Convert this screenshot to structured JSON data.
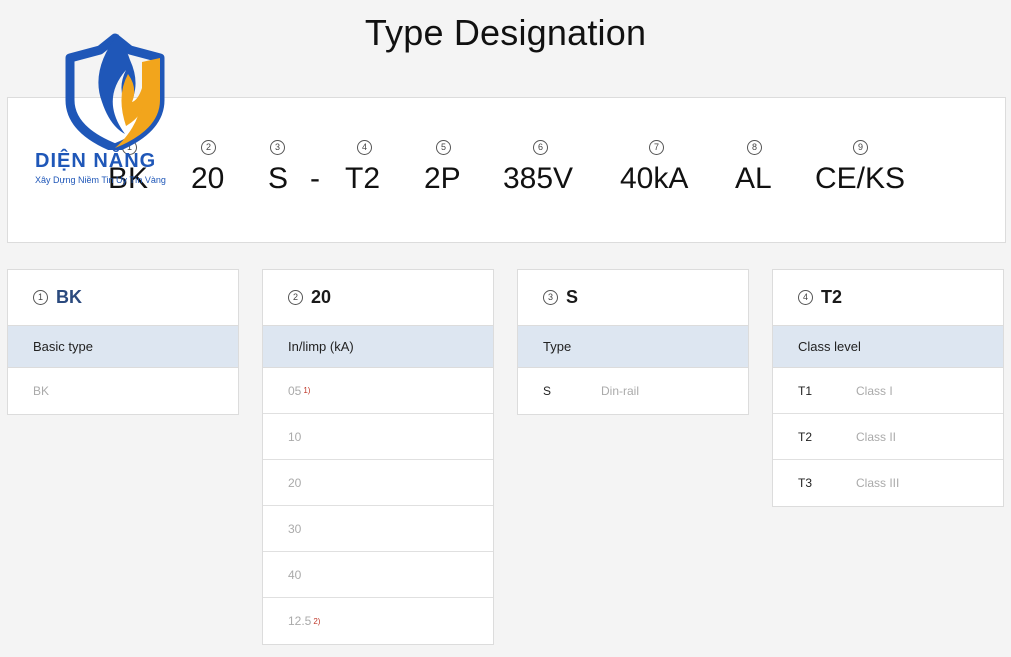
{
  "title": "Type Designation",
  "logo": {
    "name": "DIỆN NĂNG",
    "tagline": "Xây Dựng Niềm Tin Uy Tín Vàng"
  },
  "segments": [
    {
      "num": "1",
      "code": "BK"
    },
    {
      "num": "2",
      "code": "20"
    },
    {
      "num": "3",
      "code": "S"
    },
    {
      "sep": "-"
    },
    {
      "num": "4",
      "code": "T2"
    },
    {
      "num": "5",
      "code": "2P"
    },
    {
      "num": "6",
      "code": "385V"
    },
    {
      "num": "7",
      "code": "40kA"
    },
    {
      "num": "8",
      "code": "AL"
    },
    {
      "num": "9",
      "code": "CE/KS"
    }
  ],
  "cards": [
    {
      "num": "1",
      "title": "BK",
      "subtitle": "Basic type",
      "rows": [
        {
          "value": "BK"
        }
      ]
    },
    {
      "num": "2",
      "title": "20",
      "subtitle": "In/limp (kA)",
      "rows": [
        {
          "value": "05",
          "note": "1)"
        },
        {
          "value": "10"
        },
        {
          "value": "20"
        },
        {
          "value": "30"
        },
        {
          "value": "40"
        },
        {
          "value": "12.5",
          "note": "2)"
        }
      ]
    },
    {
      "num": "3",
      "title": "S",
      "subtitle": "Type",
      "rows": [
        {
          "key": "S",
          "value": "Din-rail"
        }
      ]
    },
    {
      "num": "4",
      "title": "T2",
      "subtitle": "Class level",
      "rows": [
        {
          "key": "T1",
          "value": "Class I"
        },
        {
          "key": "T2",
          "value": "Class II"
        },
        {
          "key": "T3",
          "value": "Class III"
        }
      ]
    }
  ]
}
